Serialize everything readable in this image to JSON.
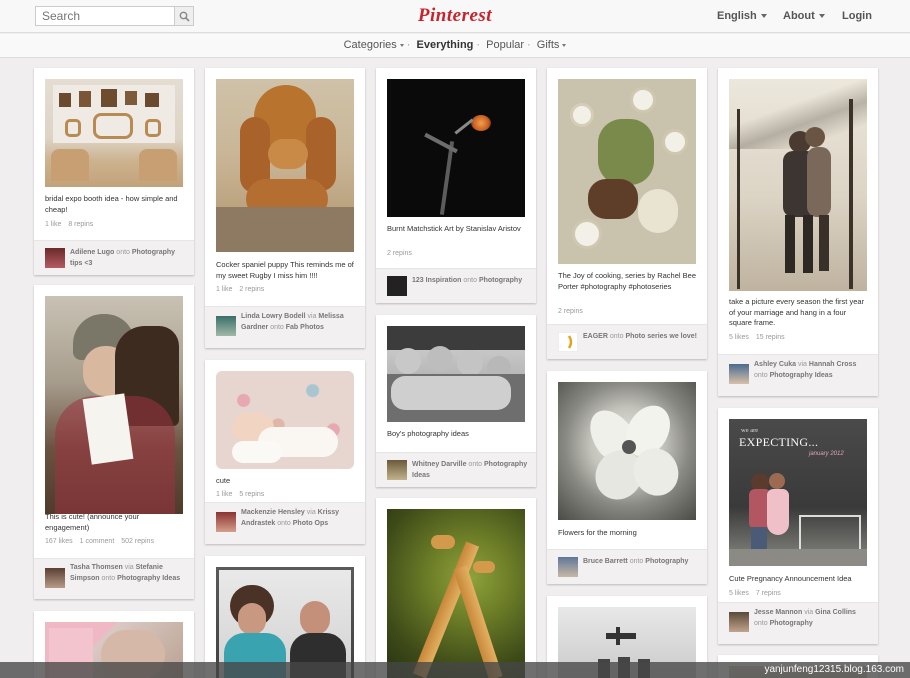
{
  "header": {
    "search_placeholder": "Search",
    "logo": "Pinterest",
    "language": "English",
    "about": "About",
    "login": "Login"
  },
  "subnav": {
    "categories": "Categories",
    "everything": "Everything",
    "popular": "Popular",
    "gifts": "Gifts"
  },
  "pins": [
    {
      "desc": "bridal expo booth idea - how simple and cheap!",
      "stats": [
        "1 like",
        "8 repins"
      ],
      "user": "Adilene Lugo",
      "onto_label": "onto",
      "board": "Photography tips <3"
    },
    {
      "desc": "This is cute! (announce your engagement)",
      "stats": [
        "167 likes",
        "1 comment",
        "502 repins"
      ],
      "user": "Tasha Thomsen",
      "via_label": "via",
      "via": "Stefanie Simpson",
      "onto_label": "onto",
      "board": "Photography Ideas"
    },
    {
      "desc": "",
      "stats": []
    },
    {
      "desc": "Cocker spaniel puppy This reminds me of my sweet Rugby I miss him !!!!",
      "stats": [
        "1 like",
        "2 repins"
      ],
      "user": "Linda Lowry Bodell",
      "via_label": "via",
      "via": "Melissa Gardner",
      "onto_label": "onto",
      "board": "Fab Photos"
    },
    {
      "desc": "cute",
      "stats": [
        "1 like",
        "5 repins"
      ],
      "user": "Mackenzie Hensley",
      "via_label": "via",
      "via": "Krissy Andrastek",
      "onto_label": "onto",
      "board": "Photo Ops"
    },
    {
      "desc": "",
      "stats": []
    },
    {
      "desc": "Burnt Matchstick Art by Stanislav Aristov",
      "stats": [
        "2 repins"
      ],
      "user": "123 Inspiration",
      "onto_label": "onto",
      "board": "Photography"
    },
    {
      "desc": "Boy's photography ideas",
      "stats": [],
      "user": "Whitney Darville",
      "onto_label": "onto",
      "board": "Photography Ideas"
    },
    {
      "desc": "",
      "stats": []
    },
    {
      "desc": "The Joy of cooking, series by Rachel Bee Porter #photography #photoseries",
      "stats": [
        "2 repins"
      ],
      "user": "EAGER",
      "onto_label": "onto",
      "board": "Photo series we love!"
    },
    {
      "desc": "Flowers for the morning",
      "stats": [],
      "user": "Bruce Barrett",
      "onto_label": "onto",
      "board": "Photography"
    },
    {
      "desc": "",
      "stats": []
    },
    {
      "desc": "take a picture every season the first year of your marriage and hang in a four square frame.",
      "stats": [
        "5 likes",
        "15 repins"
      ],
      "user": "Ashley Cuka",
      "via_label": "via",
      "via": "Hannah Cross",
      "onto_label": "onto",
      "board": "Photography Ideas"
    },
    {
      "desc": "Cute Pregnancy Announcement Idea",
      "stats": [
        "5 likes",
        "7 repins"
      ],
      "user": "Jesse Mannon",
      "via_label": "via",
      "via": "Gina Collins",
      "onto_label": "onto",
      "board": "Photography",
      "image_text": [
        "we are",
        "EXPECTING...",
        "january 2012"
      ]
    },
    {
      "desc": "",
      "stats": []
    }
  ],
  "watermark": "yanjunfeng12315.blog.163.com"
}
